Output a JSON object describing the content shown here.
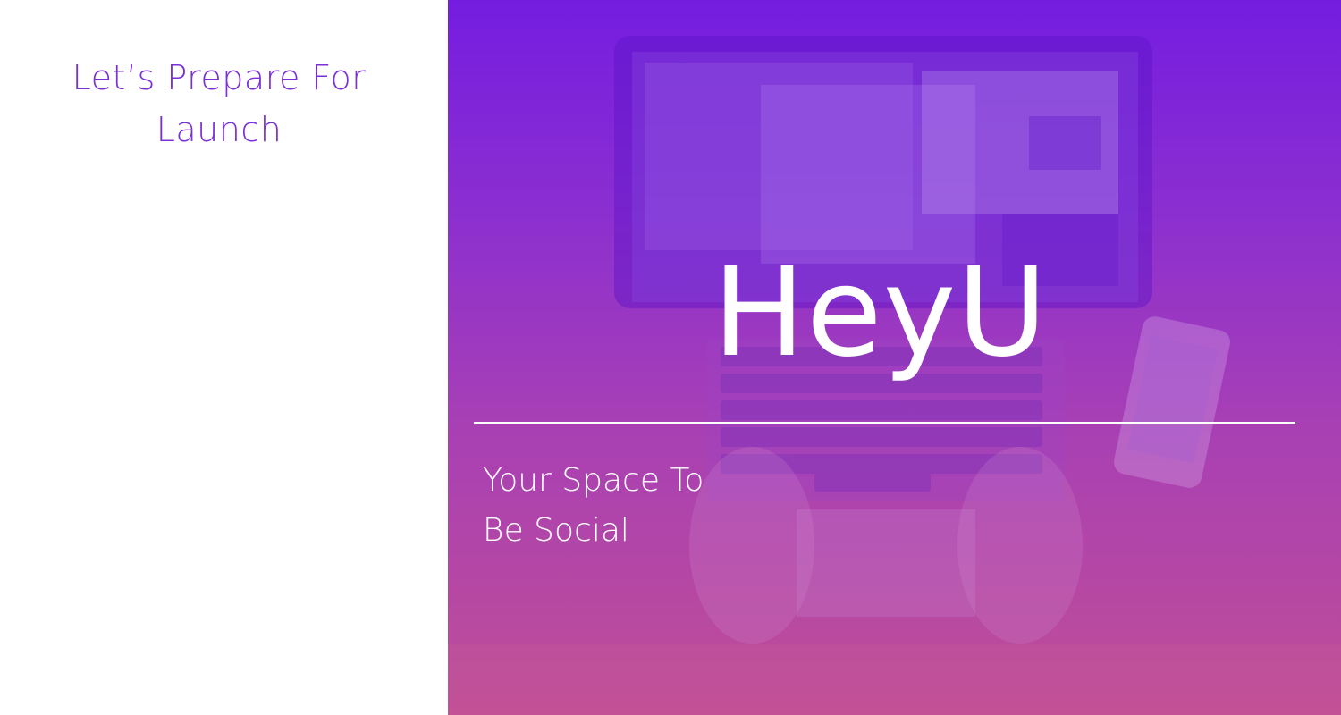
{
  "left": {
    "title_line1": "Let’s Prepare For",
    "title_line2": "Launch"
  },
  "hero": {
    "brand": "HeyU",
    "tagline_line1": "Your Space To",
    "tagline_line2": "Be Social"
  },
  "colors": {
    "accent_text": "#7b2fd6",
    "gradient_top": "#741de0",
    "gradient_bottom": "#c04e96",
    "hero_text": "#ffffff"
  },
  "background_image": {
    "icon": "laptop-and-phone-photo"
  }
}
